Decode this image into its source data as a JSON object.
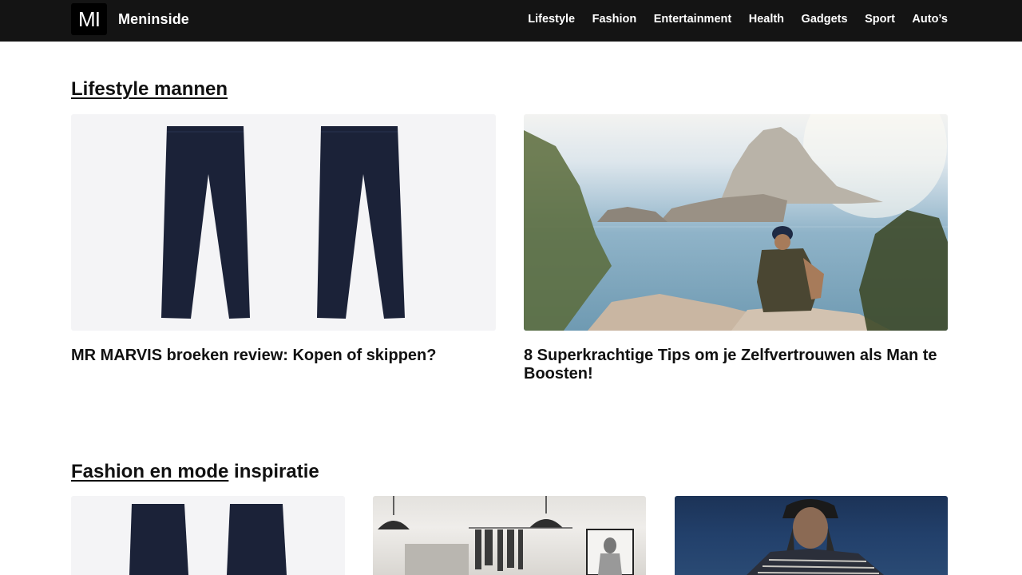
{
  "site": {
    "logo_text": "MI",
    "name": "Meninside"
  },
  "nav": {
    "items": [
      {
        "label": "Lifestyle"
      },
      {
        "label": "Fashion"
      },
      {
        "label": "Entertainment"
      },
      {
        "label": "Health"
      },
      {
        "label": "Gadgets"
      },
      {
        "label": "Sport"
      },
      {
        "label": "Auto’s"
      }
    ]
  },
  "sections": [
    {
      "title_link": "Lifestyle mannen",
      "title_rest": "",
      "cards": [
        {
          "title": "MR MARVIS broeken review: Kopen of skippen?",
          "image": "navy-chino-pants-product-photo"
        },
        {
          "title": "8 Superkrachtige Tips om je Zelfvertrouwen als Man te Boosten!",
          "image": "man-sitting-on-cliff-overlooking-sea-and-rocky-island"
        }
      ]
    },
    {
      "title_link": "Fashion en mode",
      "title_rest": " inspiratie",
      "cards": [
        {
          "image": "navy-chino-pants-product-photo"
        },
        {
          "image": "clothing-store-interior-with-pendant-lamps-and-clothing-rack"
        },
        {
          "image": "man-with-hat-and-striped-poncho-at-night"
        }
      ]
    }
  ],
  "colors": {
    "header_bg": "#141414",
    "text": "#111111",
    "image_placeholder": "#f4f4f6",
    "pants": "#1b2238"
  }
}
